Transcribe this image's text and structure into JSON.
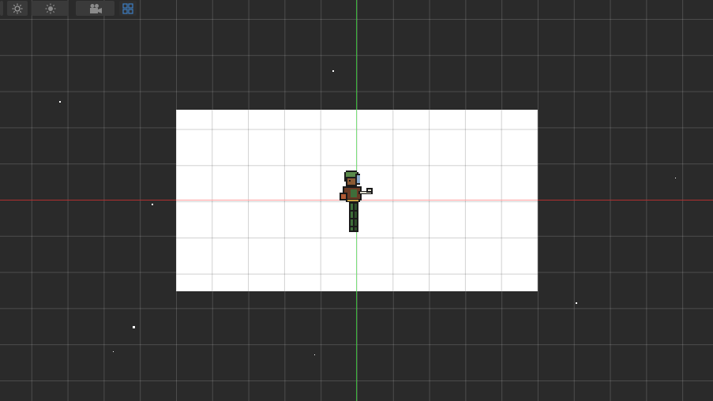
{
  "toolbar": {
    "buttons": [
      {
        "name": "sun-light-button",
        "icon": "sun-icon"
      },
      {
        "name": "sun-dim-button",
        "icon": "sun-icon"
      },
      {
        "name": "camera-button",
        "icon": "camera-icon"
      },
      {
        "name": "grid-toggle-button",
        "icon": "grid-icon",
        "active": true
      }
    ]
  },
  "scene": {
    "background_color": "#2a2a2a",
    "canvas_color": "#ffffff",
    "x_axis_color": "#b03030",
    "y_axis_color": "#3ab23a",
    "accent_color": "#3d7fc4"
  },
  "sprite": {
    "name": "pixel-character"
  }
}
